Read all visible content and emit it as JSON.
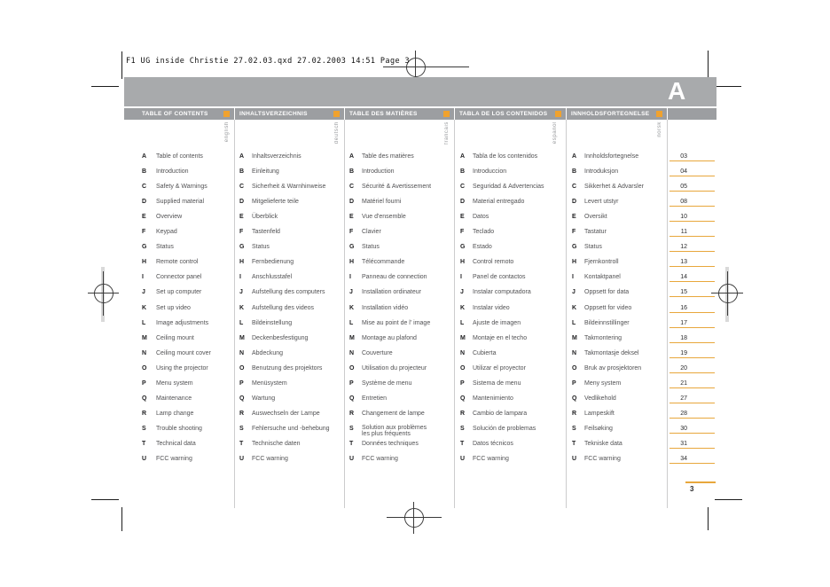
{
  "print_info": {
    "filename_line": "F1 UG inside Christie 27.02.03.qxd  27.02.2003  14:51  Page 3"
  },
  "header": {
    "section_letter": "A"
  },
  "colors": {
    "accent_orange": "#F0A22E",
    "underline_orange": "#E8A73C",
    "band_gray": "#A8AAAC",
    "strip_gray": "#9C9EA1"
  },
  "columns": [
    {
      "title": "TABLE OF CONTENTS",
      "language_label": "english",
      "entries": [
        {
          "letter": "A",
          "label": "Table of contents"
        },
        {
          "letter": "B",
          "label": "Introduction"
        },
        {
          "letter": "C",
          "label": "Safety & Warnings"
        },
        {
          "letter": "D",
          "label": "Supplied material"
        },
        {
          "letter": "E",
          "label": "Overview"
        },
        {
          "letter": "F",
          "label": "Keypad"
        },
        {
          "letter": "G",
          "label": "Status"
        },
        {
          "letter": "H",
          "label": "Remote control"
        },
        {
          "letter": "I",
          "label": "Connector panel"
        },
        {
          "letter": "J",
          "label": "Set up computer"
        },
        {
          "letter": "K",
          "label": "Set up video"
        },
        {
          "letter": "L",
          "label": "Image adjustments"
        },
        {
          "letter": "M",
          "label": "Ceiling mount"
        },
        {
          "letter": "N",
          "label": "Ceiling mount cover"
        },
        {
          "letter": "O",
          "label": "Using the projector"
        },
        {
          "letter": "P",
          "label": "Menu system"
        },
        {
          "letter": "Q",
          "label": "Maintenance"
        },
        {
          "letter": "R",
          "label": "Lamp change"
        },
        {
          "letter": "S",
          "label": "Trouble shooting"
        },
        {
          "letter": "T",
          "label": "Technical data"
        },
        {
          "letter": "U",
          "label": "FCC warning"
        }
      ]
    },
    {
      "title": "INHALTSVERZEICHNIS",
      "language_label": "deutsch",
      "entries": [
        {
          "letter": "A",
          "label": "Inhaltsverzeichnis"
        },
        {
          "letter": "B",
          "label": "Einleitung"
        },
        {
          "letter": "C",
          "label": "Sicherheit & Warnhinweise"
        },
        {
          "letter": "D",
          "label": "Mitgelieferte teile"
        },
        {
          "letter": "E",
          "label": "Überblick"
        },
        {
          "letter": "F",
          "label": "Tastenfeld"
        },
        {
          "letter": "G",
          "label": "Status"
        },
        {
          "letter": "H",
          "label": "Fernbedienung"
        },
        {
          "letter": "I",
          "label": "Anschlusstafel"
        },
        {
          "letter": "J",
          "label": "Aufstellung des computers"
        },
        {
          "letter": "K",
          "label": "Aufstellung des videos"
        },
        {
          "letter": "L",
          "label": "Bildeinstellung"
        },
        {
          "letter": "M",
          "label": "Deckenbesfestigung"
        },
        {
          "letter": "N",
          "label": "Abdeckung"
        },
        {
          "letter": "O",
          "label": "Benutzung des projektors"
        },
        {
          "letter": "P",
          "label": "Menüsystem"
        },
        {
          "letter": "Q",
          "label": "Wartung"
        },
        {
          "letter": "R",
          "label": "Auswechseln der Lampe"
        },
        {
          "letter": "S",
          "label": "Fehlersuche und -behebung"
        },
        {
          "letter": "T",
          "label": "Technische daten"
        },
        {
          "letter": "U",
          "label": "FCC warning"
        }
      ]
    },
    {
      "title": "TABLE DES MATIÈRES",
      "language_label": "francais",
      "entries": [
        {
          "letter": "A",
          "label": "Table des matières"
        },
        {
          "letter": "B",
          "label": "Introduction"
        },
        {
          "letter": "C",
          "label": "Sécurité & Avertissement"
        },
        {
          "letter": "D",
          "label": "Matériel fourni"
        },
        {
          "letter": "E",
          "label": "Vue d'ensemble"
        },
        {
          "letter": "F",
          "label": "Clavier"
        },
        {
          "letter": "G",
          "label": "Status"
        },
        {
          "letter": "H",
          "label": "Télécommande"
        },
        {
          "letter": "I",
          "label": "Panneau de connection"
        },
        {
          "letter": "J",
          "label": "Installation ordinateur"
        },
        {
          "letter": "K",
          "label": "Installation vidéo"
        },
        {
          "letter": "L",
          "label": "Mise au point de l' image"
        },
        {
          "letter": "M",
          "label": "Montage au plafond"
        },
        {
          "letter": "N",
          "label": "Couverture"
        },
        {
          "letter": "O",
          "label": "Utilisation du projecteur"
        },
        {
          "letter": "P",
          "label": "Système de menu"
        },
        {
          "letter": "Q",
          "label": "Entretien"
        },
        {
          "letter": "R",
          "label": "Changement de lampe"
        },
        {
          "letter": "S",
          "label": "Solution aux problèmes\nles plus fréquents"
        },
        {
          "letter": "T",
          "label": "Données techniques"
        },
        {
          "letter": "U",
          "label": "FCC warning"
        }
      ]
    },
    {
      "title": "TABLA DE LOS CONTENIDOS",
      "language_label": "espanol",
      "entries": [
        {
          "letter": "A",
          "label": "Tabla de los contenidos"
        },
        {
          "letter": "B",
          "label": "Introduccion"
        },
        {
          "letter": "C",
          "label": "Seguridad & Advertencias"
        },
        {
          "letter": "D",
          "label": "Material entregado"
        },
        {
          "letter": "E",
          "label": "Datos"
        },
        {
          "letter": "F",
          "label": "Teclado"
        },
        {
          "letter": "G",
          "label": "Estado"
        },
        {
          "letter": "H",
          "label": "Control remoto"
        },
        {
          "letter": "I",
          "label": "Panel de contactos"
        },
        {
          "letter": "J",
          "label": "Instalar computadora"
        },
        {
          "letter": "K",
          "label": "Instalar video"
        },
        {
          "letter": "L",
          "label": "Ajuste de imagen"
        },
        {
          "letter": "M",
          "label": "Montaje en el techo"
        },
        {
          "letter": "N",
          "label": "Cubierta"
        },
        {
          "letter": "O",
          "label": "Utilizar el proyector"
        },
        {
          "letter": "P",
          "label": "Sistema de menu"
        },
        {
          "letter": "Q",
          "label": "Mantenimiento"
        },
        {
          "letter": "R",
          "label": "Cambio de lampara"
        },
        {
          "letter": "S",
          "label": "Solución de problemas"
        },
        {
          "letter": "T",
          "label": "Datos técnicos"
        },
        {
          "letter": "U",
          "label": "FCC warning"
        }
      ]
    },
    {
      "title": "INNHOLDSFORTEGNELSE",
      "language_label": "norsk",
      "entries": [
        {
          "letter": "A",
          "label": "Innholdsfortegnelse"
        },
        {
          "letter": "B",
          "label": "Introduksjon"
        },
        {
          "letter": "C",
          "label": "Sikkerhet & Advarsler"
        },
        {
          "letter": "D",
          "label": "Levert utstyr"
        },
        {
          "letter": "E",
          "label": "Oversikt"
        },
        {
          "letter": "F",
          "label": "Tastatur"
        },
        {
          "letter": "G",
          "label": "Status"
        },
        {
          "letter": "H",
          "label": "Fjernkontroll"
        },
        {
          "letter": "I",
          "label": "Kontaktpanel"
        },
        {
          "letter": "J",
          "label": "Oppsett for data"
        },
        {
          "letter": "K",
          "label": "Oppsett for video"
        },
        {
          "letter": "L",
          "label": "Bildeinnstillinger"
        },
        {
          "letter": "M",
          "label": "Takmontering"
        },
        {
          "letter": "N",
          "label": "Takmontasje deksel"
        },
        {
          "letter": "O",
          "label": "Bruk av prosjektoren"
        },
        {
          "letter": "P",
          "label": "Meny system"
        },
        {
          "letter": "Q",
          "label": "Vedlikehold"
        },
        {
          "letter": "R",
          "label": "Lampeskift"
        },
        {
          "letter": "S",
          "label": "Feilsøking"
        },
        {
          "letter": "T",
          "label": "Tekniske data"
        },
        {
          "letter": "U",
          "label": "FCC warning"
        }
      ]
    }
  ],
  "page_numbers": [
    "03",
    "04",
    "05",
    "08",
    "10",
    "11",
    "12",
    "13",
    "14",
    "15",
    "16",
    "17",
    "18",
    "19",
    "20",
    "21",
    "27",
    "28",
    "30",
    "31",
    "34"
  ],
  "footer": {
    "page_number": "3"
  }
}
